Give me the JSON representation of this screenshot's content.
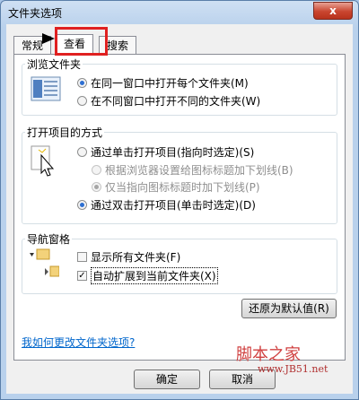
{
  "window": {
    "title": "文件夹选项",
    "close_label": "x"
  },
  "tabs": [
    {
      "label": "常规",
      "active": false
    },
    {
      "label": "查看",
      "active": true
    },
    {
      "label": "搜索",
      "active": false
    }
  ],
  "browse": {
    "title": "浏览文件夹",
    "options": [
      {
        "label": "在同一窗口中打开每个文件夹(M)",
        "selected": true
      },
      {
        "label": "在不同窗口中打开不同的文件夹(W)",
        "selected": false
      }
    ]
  },
  "open": {
    "title": "打开项目的方式",
    "single_click": "通过单击打开项目(指向时选定)(S)",
    "underline_browser": "根据浏览器设置给图标标题加下划线(B)",
    "underline_hover": "仅当指向图标标题时加下划线(P)",
    "double_click": "通过双击打开项目(单击时选定)(D)"
  },
  "nav": {
    "title": "导航窗格",
    "show_all": "显示所有文件夹(F)",
    "auto_expand": "自动扩展到当前文件夹(X)"
  },
  "restore_label": "还原为默认值(R)",
  "help_link": "我如何更改文件夹选项?",
  "footer": {
    "ok": "确定",
    "cancel": "取消"
  },
  "watermark": {
    "brand": "脚本之家",
    "site": "www.JB51.net"
  }
}
